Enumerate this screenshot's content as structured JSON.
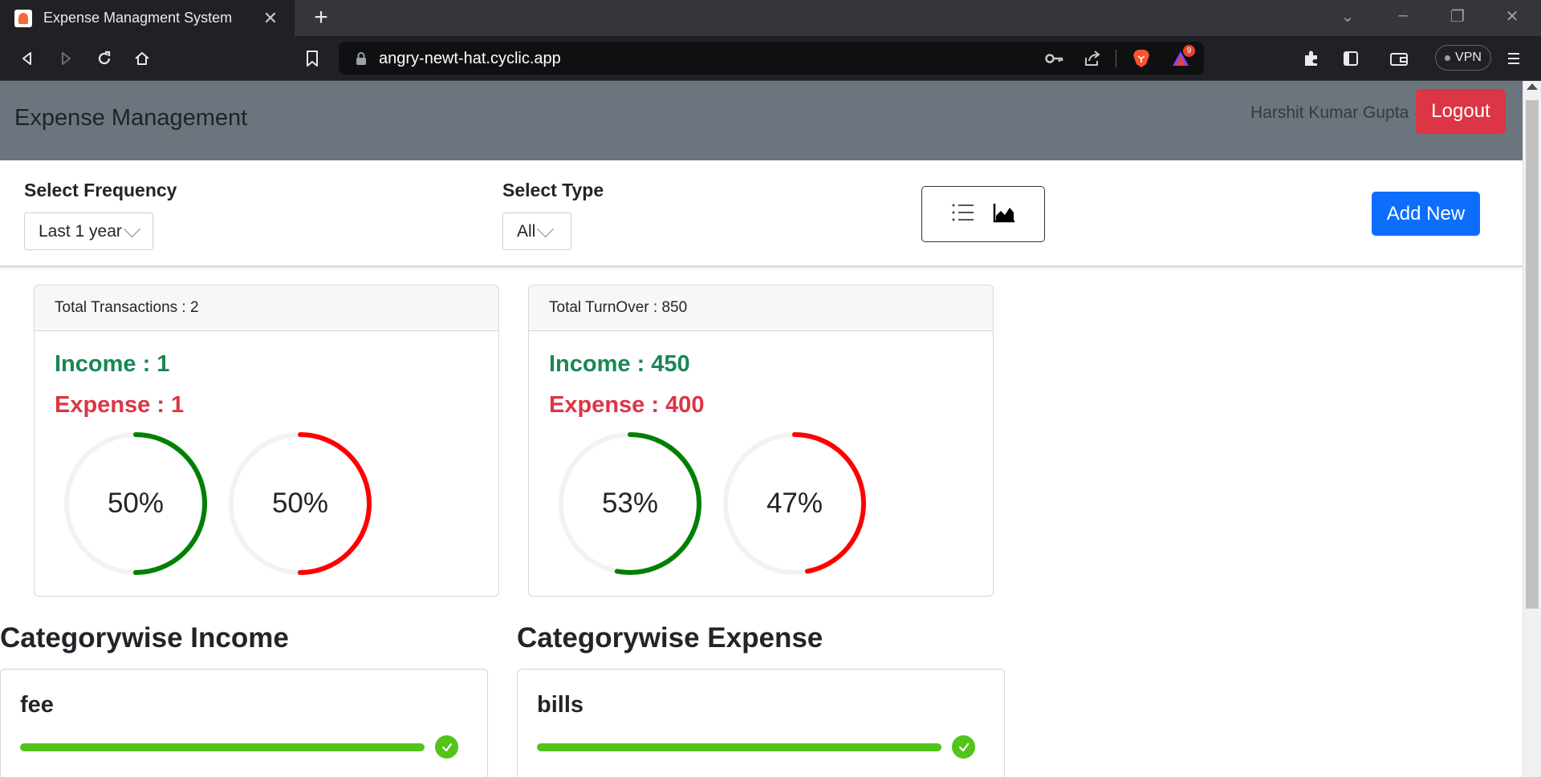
{
  "browser": {
    "tab_title": "Expense Managment System",
    "url": "angry-newt-hat.cyclic.app",
    "notification_count": "9",
    "vpn_label": "VPN"
  },
  "app": {
    "brand": "Expense Management",
    "user_name": "Harshit Kumar Gupta",
    "logout_label": "Logout"
  },
  "filters": {
    "frequency_label": "Select Frequency",
    "frequency_value": "Last 1 year",
    "type_label": "Select Type",
    "type_value": "All",
    "add_new_label": "Add New"
  },
  "summary_cards": [
    {
      "header": "Total Transactions : 2",
      "income": "Income : 1",
      "expense": "Expense : 1",
      "income_percent": 50,
      "income_percent_label": "50%",
      "expense_percent": 50,
      "expense_percent_label": "50%"
    },
    {
      "header": "Total TurnOver : 850",
      "income": "Income : 450",
      "expense": "Expense : 400",
      "income_percent": 53,
      "income_percent_label": "53%",
      "expense_percent": 47,
      "expense_percent_label": "47%"
    }
  ],
  "categories": {
    "income_title": "Categorywise Income",
    "expense_title": "Categorywise Expense",
    "income_items": [
      {
        "name": "fee",
        "percent": 100
      }
    ],
    "expense_items": [
      {
        "name": "bills",
        "percent": 100
      }
    ]
  },
  "colors": {
    "income_ring": "#008000",
    "expense_ring": "#ff0000",
    "ring_track": "#f2f2f2",
    "progress": "#52c41a"
  }
}
